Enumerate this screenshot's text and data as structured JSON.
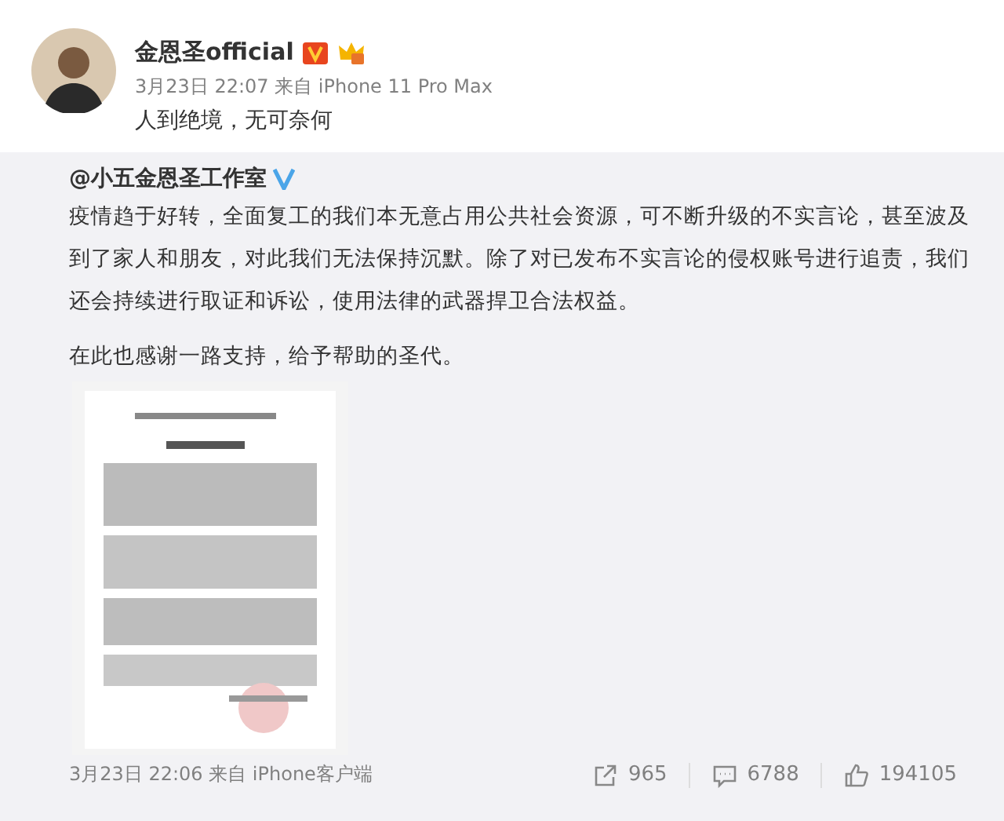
{
  "post": {
    "author": "金恩圣official",
    "meta": "3月23日 22:07 来自 iPhone 11 Pro Max",
    "text": "人到绝境，无可奈何"
  },
  "repost": {
    "author": "@小五金恩圣工作室",
    "paragraphs": [
      "疫情趋于好转，全面复工的我们本无意占用公共社会资源，可不断升级的不实言论，甚至波及到了家人和朋友，对此我们无法保持沉默。除了对已发布不实言论的侵权账号进行追责，我们还会持续进行取证和诉讼，使用法律的武器捍卫合法权益。",
      "在此也感谢一路支持，给予帮助的圣代。"
    ],
    "image": {
      "kind": "picture"
    },
    "meta": "3月23日 22:06 来自 iPhone客户端",
    "actions": [
      {
        "kind": "share",
        "count": "965"
      },
      {
        "kind": "comment",
        "count": "6788"
      },
      {
        "kind": "like",
        "count": "194105"
      }
    ]
  }
}
